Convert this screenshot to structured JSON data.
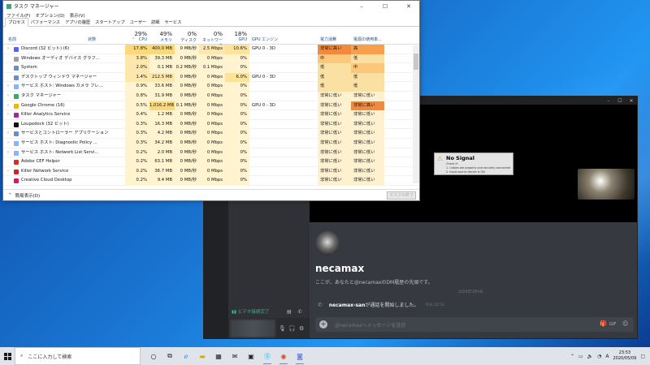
{
  "taskmanager": {
    "title": "タスク マネージャー",
    "menu": [
      "ファイル(F)",
      "オプション(O)",
      "表示(V)"
    ],
    "tabs": [
      "プロセス",
      "パフォーマンス",
      "アプリの履歴",
      "スタートアップ",
      "ユーザー",
      "詳細",
      "サービス"
    ],
    "active_tab": "プロセス",
    "col_name": "名前",
    "col_status": "状態",
    "col_gpu_engine": "GPU エンジン",
    "col_power": "電力消費",
    "col_power_trend": "電源の使用率...",
    "stats": [
      {
        "pct": "29%",
        "label": "CPU"
      },
      {
        "pct": "49%",
        "label": "メモリ"
      },
      {
        "pct": "0%",
        "label": "ディスク"
      },
      {
        "pct": "0%",
        "label": "ネットワーク"
      },
      {
        "pct": "18%",
        "label": "GPU"
      }
    ],
    "rows": [
      {
        "name": "Discord (32 ビット) (6)",
        "cpu": "17.8%",
        "mem": "400.0 MB",
        "disk": "0 MB/秒",
        "net": "2.5 Mbps",
        "gpu": "10.6%",
        "engine": "GPU 0 - 3D",
        "power": "非常に高い",
        "trend": "高",
        "exp": "›"
      },
      {
        "name": "Windows オーディオ デバイス グラフ...",
        "cpu": "3.8%",
        "mem": "39.3 MB",
        "disk": "0 MB/秒",
        "net": "0 Mbps",
        "gpu": "0%",
        "engine": "",
        "power": "中",
        "trend": "低",
        "exp": ""
      },
      {
        "name": "System",
        "cpu": "2.0%",
        "mem": "0.1 MB",
        "disk": "0.2 MB/秒",
        "net": "0.1 Mbps",
        "gpu": "0%",
        "engine": "",
        "power": "低",
        "trend": "中",
        "exp": ""
      },
      {
        "name": "デスクトップ ウィンドウ マネージャー",
        "cpu": "1.4%",
        "mem": "212.5 MB",
        "disk": "0 MB/秒",
        "net": "0 Mbps",
        "gpu": "6.0%",
        "engine": "GPU 0 - 3D",
        "power": "低",
        "trend": "低",
        "exp": ""
      },
      {
        "name": "サービス ホスト: Windows カメラ フレ...",
        "cpu": "0.9%",
        "mem": "33.6 MB",
        "disk": "0 MB/秒",
        "net": "0 Mbps",
        "gpu": "0%",
        "engine": "",
        "power": "低",
        "trend": "低",
        "exp": "›"
      },
      {
        "name": "タスク マネージャー",
        "cpu": "0.8%",
        "mem": "31.9 MB",
        "disk": "0 MB/秒",
        "net": "0 Mbps",
        "gpu": "0%",
        "engine": "",
        "power": "非常に低い",
        "trend": "非常に低い",
        "exp": "›"
      },
      {
        "name": "Google Chrome (16)",
        "cpu": "0.5%",
        "mem": "1,016.2 MB",
        "disk": "0.1 MB/秒",
        "net": "0 Mbps",
        "gpu": "0%",
        "engine": "GPU 0 - 3D",
        "power": "非常に低い",
        "trend": "非常に高い",
        "exp": "›"
      },
      {
        "name": "Killer Analytics Service",
        "cpu": "0.4%",
        "mem": "1.2 MB",
        "disk": "0 MB/秒",
        "net": "0 Mbps",
        "gpu": "0%",
        "engine": "",
        "power": "非常に低い",
        "trend": "非常に低い",
        "exp": "›"
      },
      {
        "name": "Loupedeck (32 ビット)",
        "cpu": "0.3%",
        "mem": "16.3 MB",
        "disk": "0 MB/秒",
        "net": "0 Mbps",
        "gpu": "0%",
        "engine": "",
        "power": "非常に低い",
        "trend": "非常に低い",
        "exp": ""
      },
      {
        "name": "サービスとコントローラー アプリケーション",
        "cpu": "0.3%",
        "mem": "4.2 MB",
        "disk": "0 MB/秒",
        "net": "0 Mbps",
        "gpu": "0%",
        "engine": "",
        "power": "非常に低い",
        "trend": "非常に低い",
        "exp": "›"
      },
      {
        "name": "サービス ホスト: Diagnostic Policy ...",
        "cpu": "0.3%",
        "mem": "34.2 MB",
        "disk": "0 MB/秒",
        "net": "0 Mbps",
        "gpu": "0%",
        "engine": "",
        "power": "非常に低い",
        "trend": "非常に低い",
        "exp": "›"
      },
      {
        "name": "サービス ホスト: Network List Servi...",
        "cpu": "0.2%",
        "mem": "2.0 MB",
        "disk": "0 MB/秒",
        "net": "0 Mbps",
        "gpu": "0%",
        "engine": "",
        "power": "非常に低い",
        "trend": "非常に低い",
        "exp": "›"
      },
      {
        "name": "Adobe CEF Helper",
        "cpu": "0.2%",
        "mem": "63.1 MB",
        "disk": "0 MB/秒",
        "net": "0 Mbps",
        "gpu": "0%",
        "engine": "",
        "power": "非常に低い",
        "trend": "非常に低い",
        "exp": ""
      },
      {
        "name": "Killer Network Service",
        "cpu": "0.2%",
        "mem": "36.7 MB",
        "disk": "0 MB/秒",
        "net": "0 Mbps",
        "gpu": "0%",
        "engine": "",
        "power": "非常に低い",
        "trend": "非常に低い",
        "exp": "›"
      },
      {
        "name": "Creative Cloud Desktop",
        "cpu": "0.2%",
        "mem": "9.4 MB",
        "disk": "0 MB/秒",
        "net": "0 Mbps",
        "gpu": "0%",
        "engine": "",
        "power": "非常に低い",
        "trend": "非常に低い",
        "exp": ""
      }
    ],
    "fewer_details": "簡易表示(D)",
    "end_task": "タスクの終了(E)"
  },
  "discord": {
    "no_signal": {
      "title": "No Signal",
      "line1": "Check if:",
      "line2": "1. Cables are properly and securely connected",
      "line3": "2. Input source device is ON"
    },
    "username": "necamax",
    "intro": "ここが、あなたと@necamaxのDM履歴の先頭です。",
    "date": "2020年5月9日",
    "call_user": "necamax-san",
    "call_text": "が通話を開始しました。",
    "call_time": "今日 23:53",
    "input_placeholder": "@necamaxへメッセージを送信",
    "voice_status": "ビデオ接続完了"
  },
  "taskbar": {
    "search_placeholder": "ここに入力して検索",
    "time": "23:53",
    "date": "2020/05/09"
  },
  "colors": {
    "discord_green": "#43b581",
    "accent_blue": "#1f4e8c"
  }
}
